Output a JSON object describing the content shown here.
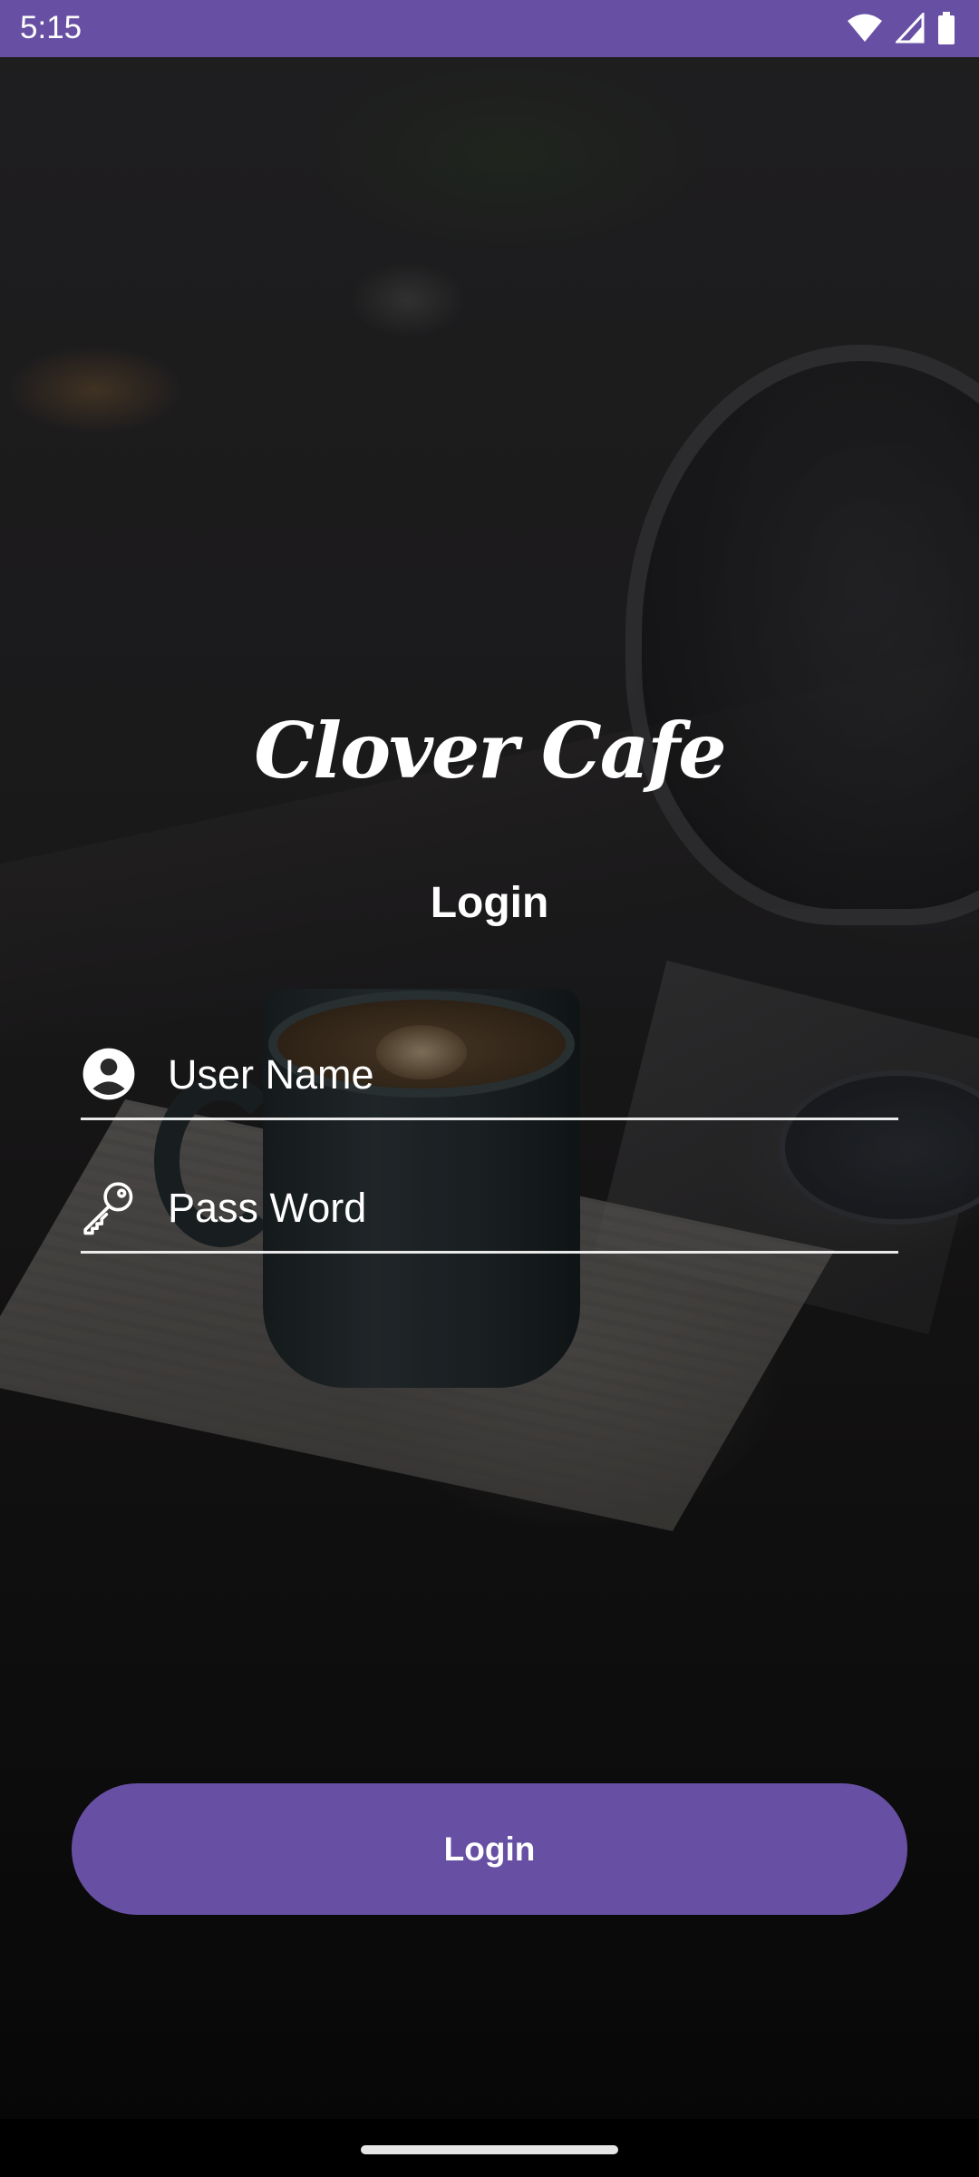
{
  "status_bar": {
    "time": "5:15",
    "icons": [
      "wifi-icon",
      "cellular-signal-icon",
      "battery-icon"
    ],
    "background_color": "#6750a4"
  },
  "app": {
    "title": "Clover Cafe",
    "heading": "Login"
  },
  "form": {
    "username": {
      "placeholder": "User Name",
      "value": "",
      "icon": "account-circle-icon"
    },
    "password": {
      "placeholder": "Pass Word",
      "value": "",
      "icon": "key-icon"
    }
  },
  "actions": {
    "login_label": "Login",
    "button_color": "#6750a4"
  },
  "colors": {
    "accent": "#6750a4",
    "text": "#ffffff"
  }
}
